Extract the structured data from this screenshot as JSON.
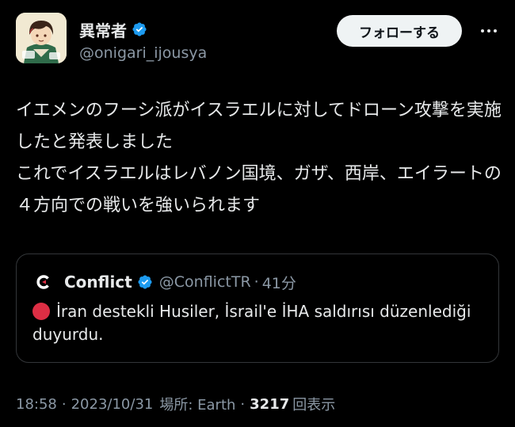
{
  "author": {
    "display_name": "異常者",
    "handle": "@onigari_ijousya",
    "verified": true
  },
  "follow_button_label": "フォローする",
  "more_icon": "ellipsis-icon",
  "tweet": {
    "text": "イエメンのフーシ派がイスラエルに対してドローン攻撃を実施したと発表しました\nこれでイスラエルはレバノン国境、ガザ、西岸、エイラートの４方向での戦いを強いられます"
  },
  "quote": {
    "avatar_letter": "C",
    "display_name": "Conflict",
    "verified": true,
    "handle": "@ConflictTR",
    "dot": "·",
    "time": "41分",
    "emoji": "red-circle",
    "text": "İran destekli Husiler, İsrail'e İHA saldırısı düzenlediği duyurdu."
  },
  "meta": {
    "time": "18:58",
    "date": "2023/10/31",
    "location_label": "場所: Earth",
    "views_count": "3217",
    "views_label": "回表示",
    "separator": "·"
  },
  "colors": {
    "background": "#000000",
    "text": "#e7e9ea",
    "secondary": "#8b98a5",
    "verified_blue": "#1d9bf0",
    "border": "#333639",
    "follow_bg": "#eff3f4"
  }
}
